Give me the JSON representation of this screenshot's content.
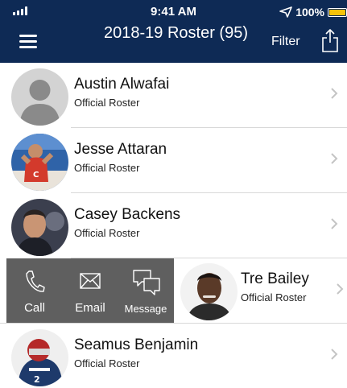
{
  "status_bar": {
    "time": "9:41 AM",
    "battery_percent": "100%",
    "battery_level": 1.0,
    "battery_color": "#f5c20a"
  },
  "nav": {
    "title": "2018-19 Roster (95)",
    "filter_label": "Filter",
    "menu_icon": "hamburger-menu-icon",
    "share_icon": "share-icon"
  },
  "colors": {
    "header_bg": "#0e2a55",
    "action_bg": "#5f5f5f"
  },
  "roster": [
    {
      "name": "Austin Alwafai",
      "subtitle": "Official Roster",
      "avatar": "placeholder-person"
    },
    {
      "name": "Jesse Attaran",
      "subtitle": "Official Roster",
      "avatar": "photo"
    },
    {
      "name": "Casey Backens",
      "subtitle": "Official Roster",
      "avatar": "photo"
    },
    {
      "name": "Tre Bailey",
      "subtitle": "Official Roster",
      "avatar": "photo"
    },
    {
      "name": "Seamus Benjamin",
      "subtitle": "Official Roster",
      "avatar": "photo"
    }
  ],
  "swipe_actions": {
    "call_label": "Call",
    "email_label": "Email",
    "message_label": "Message"
  }
}
